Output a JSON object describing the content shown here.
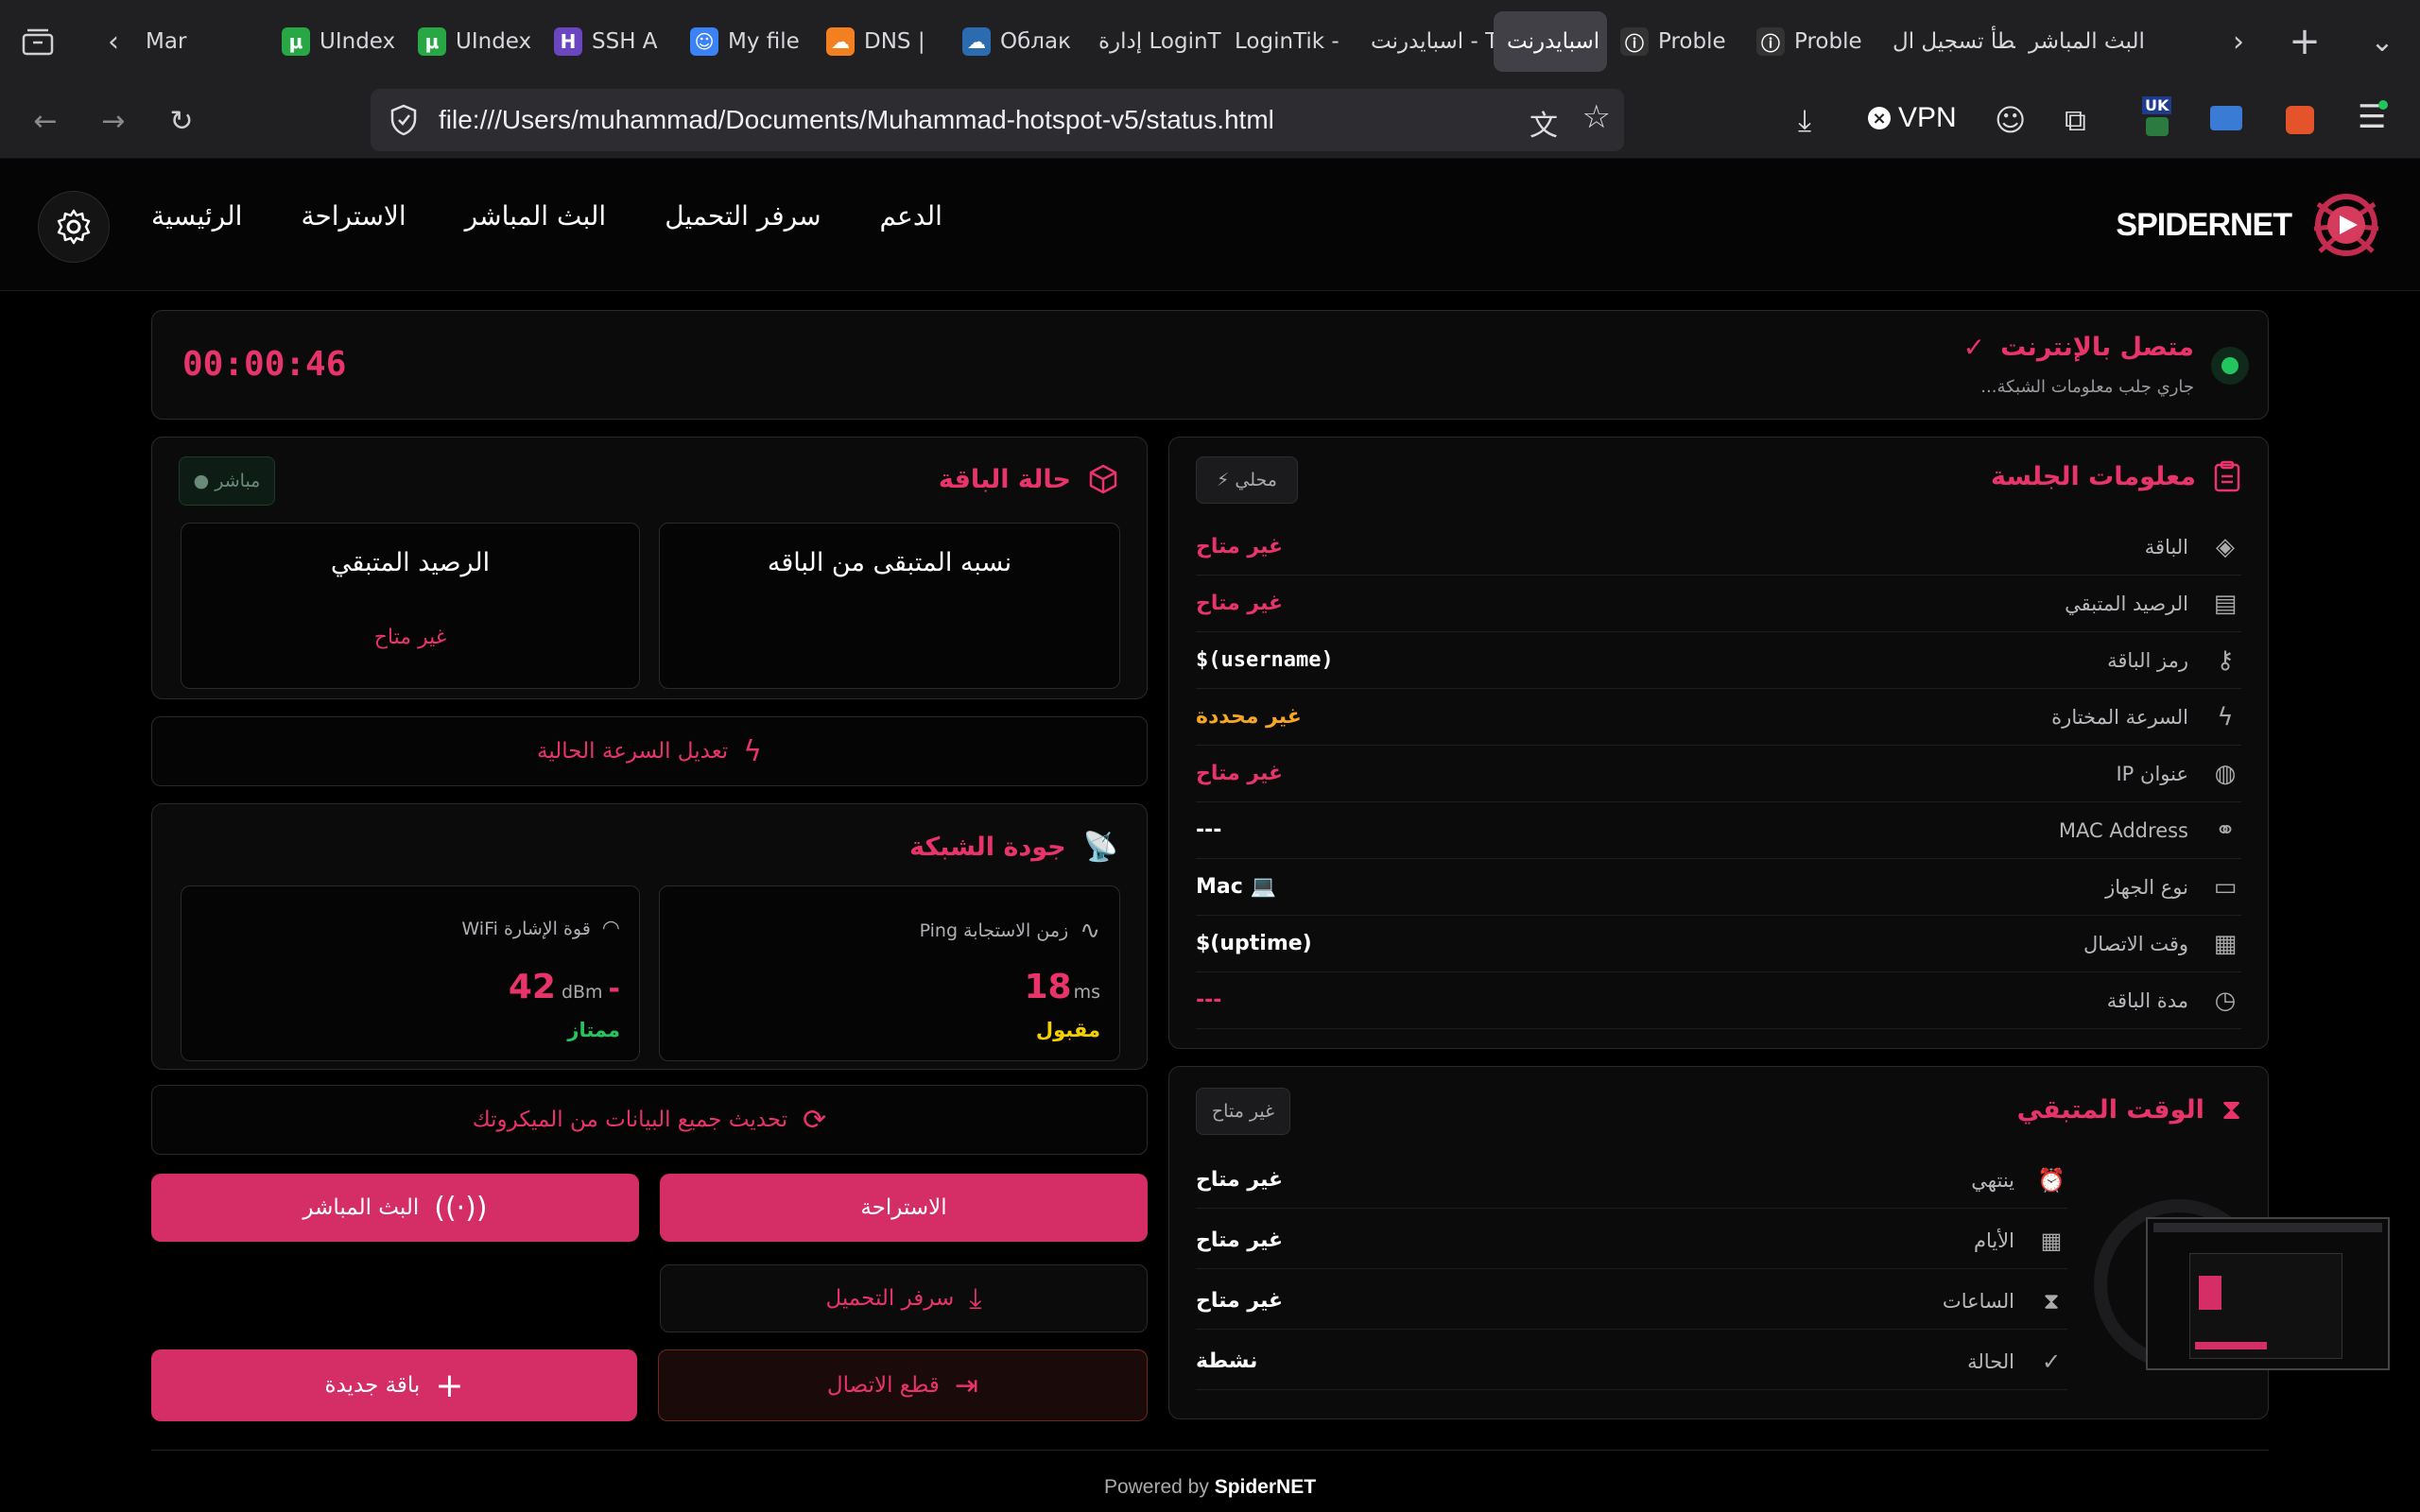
{
  "browser": {
    "tabs": [
      {
        "label": "Mar",
        "fav": ""
      },
      {
        "label": "UIndex",
        "fav": "μ"
      },
      {
        "label": "UIndex",
        "fav": "μ"
      },
      {
        "label": "SSH A",
        "fav": "H"
      },
      {
        "label": "My file",
        "fav": "☺"
      },
      {
        "label": "DNS |",
        "fav": "☁"
      },
      {
        "label": "Облак",
        "fav": "☁"
      },
      {
        "label": "إدارة LoginTik",
        "fav": ""
      },
      {
        "label": "LoginTik -",
        "fav": ""
      },
      {
        "label": "اسبايدرنت - T",
        "fav": ""
      },
      {
        "label": "اسبايدرنت",
        "fav": ""
      },
      {
        "label": "Proble",
        "fav": "ⓘ"
      },
      {
        "label": "Proble",
        "fav": "ⓘ"
      },
      {
        "label": "خطأ تسجيل ال",
        "fav": ""
      },
      {
        "label": "البث المباشر",
        "fav": ""
      }
    ],
    "url": "file:///Users/muhammad/Documents/Muhammad-hotspot-v5/status.html",
    "vpn_label": "VPN",
    "flag_label": "UK"
  },
  "nav": {
    "brand": "SPIDERNET",
    "links": [
      "الرئيسية",
      "الاستراحة",
      "البث المباشر",
      "سرفر التحميل",
      "الدعم"
    ]
  },
  "status": {
    "title": "متصل بالإنترنت",
    "subtitle": "...جاري جلب معلومات الشبكة",
    "timer": "00:00:46"
  },
  "package": {
    "title": "حالة الباقة",
    "badge": "● مباشر",
    "box_right_title": "نسبه المتبقى من الباقه",
    "box_left_title": "الرصيد المتبقي",
    "box_left_value": "غير متاح"
  },
  "speed_button": "تعديل السرعة الحالية",
  "network": {
    "title": "جودة الشبكة",
    "ping_label": "زمن الاستجابة Ping",
    "ping_value": "18",
    "ping_unit": "ms",
    "ping_status": "مقبول",
    "wifi_label": "قوة الإشارة WiFi",
    "wifi_value": "42",
    "wifi_unit": "dBm",
    "wifi_sign": "-",
    "wifi_status": "ممتاز"
  },
  "refresh_button": "تحديث جميع البيانات من الميكروتك",
  "buttons": {
    "rest": "الاستراحة",
    "live": "البث المباشر",
    "download": "سرفر التحميل",
    "disconnect": "قطع الاتصال",
    "new_package": "باقة جديدة"
  },
  "session": {
    "title": "معلومات الجلسة",
    "badge": "⚡ محلي",
    "rows": [
      {
        "label": "الباقة",
        "value": "غير متاح"
      },
      {
        "label": "الرصيد المتبقي",
        "value": "غير متاح"
      },
      {
        "label": "رمز الباقة",
        "value": "$(username)"
      },
      {
        "label": "السرعة المختارة",
        "value": "غير محددة"
      },
      {
        "label": "عنوان IP",
        "value": "غير  متاح"
      },
      {
        "label": "MAC Address",
        "value": "---"
      },
      {
        "label": "نوع الجهاز",
        "value": "Mac 💻"
      },
      {
        "label": "وقت الاتصال",
        "value": "$(uptime)"
      },
      {
        "label": "مدة الباقة",
        "value": "---"
      }
    ]
  },
  "remaining": {
    "title": "الوقت المتبقي",
    "badge": "غير متاح",
    "rows": [
      {
        "label": "ينتهي",
        "value": "غير متاح"
      },
      {
        "label": "الأيام",
        "value": "غير متاح"
      },
      {
        "label": "الساعات",
        "value": "غير متاح"
      },
      {
        "label": "الحالة",
        "value": "نشطة"
      }
    ]
  },
  "footer": {
    "prefix": "Powered by",
    "brand": "SpiderNET"
  },
  "colors": {
    "accent": "#e8336b",
    "online": "#22c55e",
    "warning": "#f5a623",
    "good": "#22c55e",
    "ok": "#f5d000"
  }
}
